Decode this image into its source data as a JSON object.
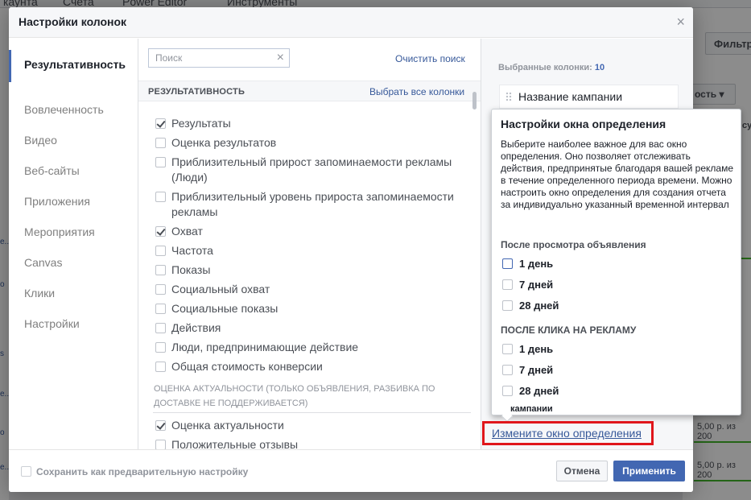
{
  "background": {
    "topbar": [
      "каунта",
      "Счета",
      "Power Editor",
      "Инструменты"
    ],
    "filter_label": "Фильтр",
    "columns_label": "ость",
    "cells": [
      "5,00 р. из 200",
      "5,00 р. из 200",
      "5,00 р. из 200"
    ],
    "right_snippets": [
      "су",
      "с"
    ],
    "left_snippets": [
      "e...",
      "o",
      "s",
      "e...",
      "o",
      "e...",
      "le",
      "ion"
    ]
  },
  "modal": {
    "title": "Настройки колонок",
    "close_icon": "×",
    "sidebar": [
      {
        "label": "Результативность",
        "active": true
      },
      {
        "label": "Вовлеченность",
        "active": false
      },
      {
        "label": "Видео",
        "active": false
      },
      {
        "label": "Веб-сайты",
        "active": false
      },
      {
        "label": "Приложения",
        "active": false
      },
      {
        "label": "Мероприятия",
        "active": false
      },
      {
        "label": "Canvas",
        "active": false
      },
      {
        "label": "Клики",
        "active": false
      },
      {
        "label": "Настройки",
        "active": false
      }
    ],
    "search": {
      "placeholder": "Поиск",
      "value": "",
      "clear_icon": "×",
      "clear_label": "Очистить поиск"
    },
    "section": {
      "title": "РЕЗУЛЬТАТИВНОСТЬ",
      "select_all": "Выбрать все колонки"
    },
    "options": [
      {
        "label": "Результаты",
        "checked": true
      },
      {
        "label": "Оценка результатов",
        "checked": false
      },
      {
        "label": "Приблизительный прирост запоминаемости рекламы (Люди)",
        "checked": false
      },
      {
        "label": "Приблизительный уровень прироста запоминаемости рекламы",
        "checked": false
      },
      {
        "label": "Охват",
        "checked": true
      },
      {
        "label": "Частота",
        "checked": false
      },
      {
        "label": "Показы",
        "checked": false
      },
      {
        "label": "Социальный охват",
        "checked": false
      },
      {
        "label": "Социальные показы",
        "checked": false
      },
      {
        "label": "Действия",
        "checked": false
      },
      {
        "label": "Люди, предпринимающие действие",
        "checked": false
      },
      {
        "label": "Общая стоимость конверсии",
        "checked": false
      }
    ],
    "subsection_title": "ОЦЕНКА АКТУАЛЬНОСТИ (ТОЛЬКО ОБЪЯВЛЕНИЯ, РАЗБИВКА ПО ДОСТАВКЕ НЕ ПОДДЕРЖИВАЕТСЯ)",
    "sub_options": [
      {
        "label": "Оценка актуальности",
        "checked": true
      },
      {
        "label": "Положительные отзывы",
        "checked": false
      }
    ],
    "selected": {
      "label": "Выбранные колонки:",
      "count": "10",
      "first_item": "Название кампании"
    },
    "change_window_link": "Измените окно определения",
    "footer": {
      "save_preset": "Сохранить как предварительную настройку",
      "cancel": "Отмена",
      "apply": "Применить"
    }
  },
  "popover": {
    "title": "Настройки окна определения",
    "description": "Выберите наиболее важное для вас окно определения. Оно позволяет отслеживать действия, предпринятые благодаря вашей рекламе в течение определенного периода времени. Можно настроить окно определения для создания отчета за индивидуально указанный временной интервал",
    "view_title": "После просмотра объявления",
    "view_options": [
      {
        "label": "1 день",
        "checked": false
      },
      {
        "label": "7 дней",
        "checked": false
      },
      {
        "label": "28 дней",
        "checked": false
      }
    ],
    "click_title": "ПОСЛЕ КЛИКА НА РЕКЛАМУ",
    "click_options": [
      {
        "label": "1 день",
        "checked": false
      },
      {
        "label": "7 дней",
        "checked": false
      },
      {
        "label": "28 дней",
        "checked": false
      }
    ],
    "peek_text": "кампании"
  },
  "colors": {
    "accent": "#4267b2",
    "link": "#365899",
    "highlight": "#e0161b"
  }
}
